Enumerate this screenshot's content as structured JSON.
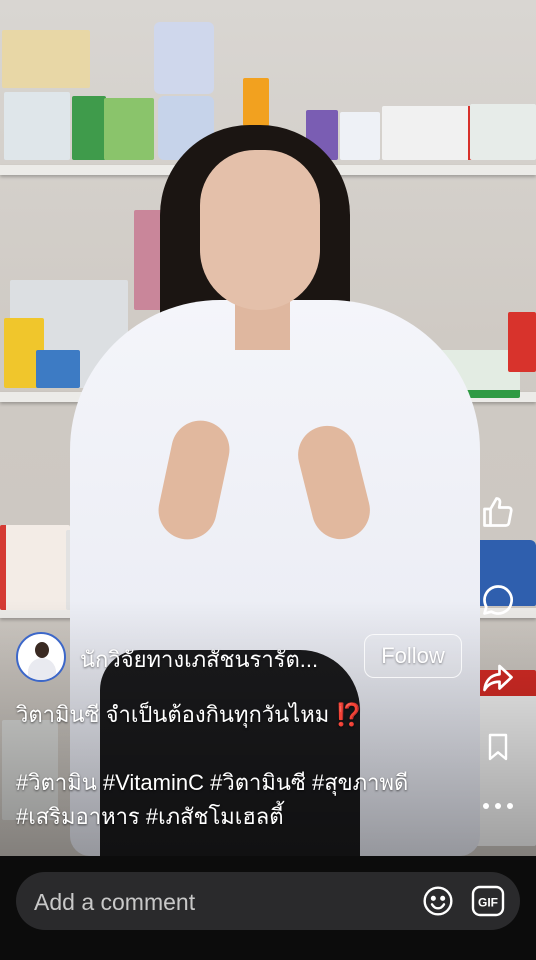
{
  "post": {
    "author_name": "นักวิจัยทางเภสัชนรารัต...",
    "follow_label": "Follow",
    "caption": "วิตามินซี จำเป็นต้องกินทุกวันไหม",
    "caption_emoji": "⁉️",
    "hashtags": [
      "#วิตามิน",
      "#VitaminC",
      "#วิตามินซี",
      "#สุขภาพดี",
      "#เสริมอาหาร",
      "#เภสัชโมเฮลตี้"
    ]
  },
  "actions": {
    "like_icon": "thumbs-up-icon",
    "comment_icon": "comment-bubble-icon",
    "share_icon": "share-arrow-icon",
    "save_icon": "bookmark-icon",
    "more_icon": "more-dots-icon"
  },
  "comment_bar": {
    "placeholder": "Add a comment",
    "emoji_icon": "smiley-icon",
    "gif_icon": "gif-icon"
  },
  "colors": {
    "follow_border": "#ffffff",
    "caption_emoji": "#e2332a",
    "comment_box": "#2a2a2c",
    "avatar_ring": "#3c67c9"
  }
}
